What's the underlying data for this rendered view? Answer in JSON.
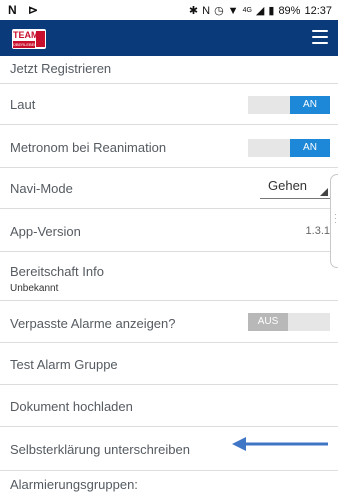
{
  "status_bar": {
    "left_icons": "N ⊳",
    "signal_text": "4G",
    "battery_percent": "89%",
    "time": "12:37"
  },
  "app_bar": {
    "logo_text": "TEAM",
    "logo_sub": "ÜBERLEBEN",
    "menu_icon": "hamburger-menu-icon"
  },
  "settings": {
    "register": {
      "label": "Jetzt Registrieren"
    },
    "laut": {
      "label": "Laut",
      "state": "AN"
    },
    "metronom": {
      "label": "Metronom bei Reanimation",
      "state": "AN"
    },
    "navi": {
      "label": "Navi-Mode",
      "value": "Gehen"
    },
    "version": {
      "label": "App-Version",
      "value": "1.3.1"
    },
    "bereitschaft": {
      "label": "Bereitschaft Info",
      "value": "Unbekannt"
    },
    "verpasste": {
      "label": "Verpasste Alarme anzeigen?",
      "state": "AUS"
    },
    "test_alarm": {
      "label": "Test Alarm Gruppe"
    },
    "dokument": {
      "label": "Dokument hochladen"
    },
    "selbst": {
      "label": "Selbsterklärung unterschreiben"
    },
    "alarmierung": {
      "label": "Alarmierungsgruppen:"
    }
  },
  "colors": {
    "appbar": "#0b3a7a",
    "toggle_on": "#1d88d8",
    "arrow": "#3f76c6"
  }
}
